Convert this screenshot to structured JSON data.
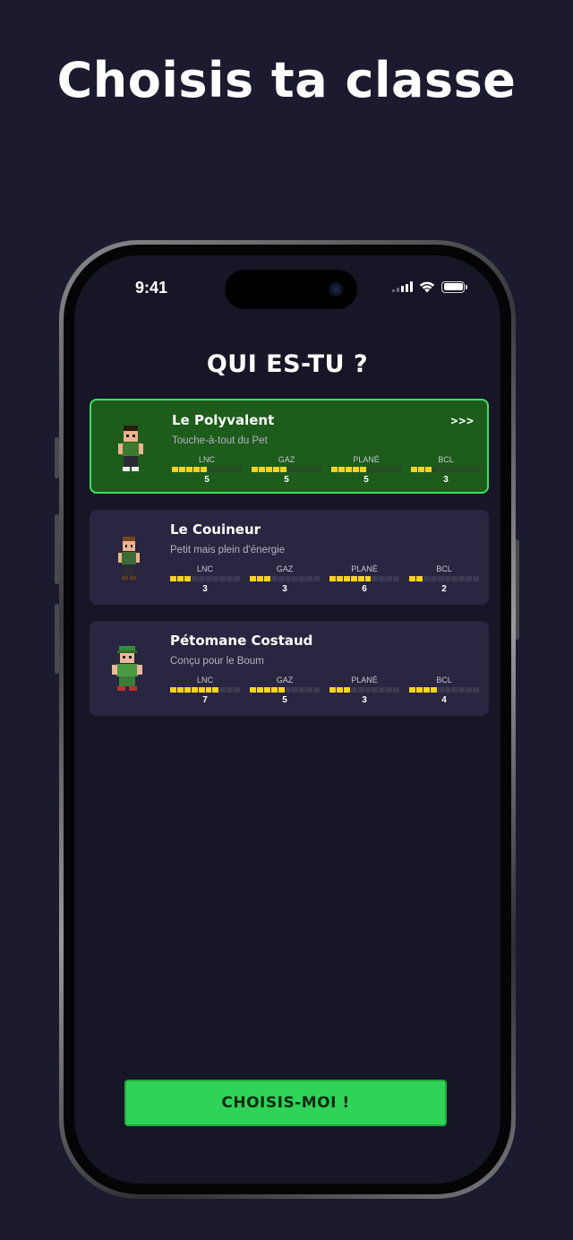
{
  "headline": "Choisis ta classe",
  "status_bar": {
    "time": "9:41"
  },
  "screen_title": "QUI ES-TU ?",
  "classes": [
    {
      "name": "Le Polyvalent",
      "subtitle": "Touche-à-tout du Pet",
      "selected": true,
      "arrows": ">>>",
      "avatar": "character-green-shirt-icon",
      "stats": [
        {
          "label": "LNC",
          "value": "5"
        },
        {
          "label": "GAZ",
          "value": "5"
        },
        {
          "label": "PLANÉ",
          "value": "5"
        },
        {
          "label": "BCL",
          "value": "3"
        }
      ]
    },
    {
      "name": "Le Couineur",
      "subtitle": "Petit mais plein d'énergie",
      "selected": false,
      "avatar": "character-small-brown-hair-icon",
      "stats": [
        {
          "label": "LNC",
          "value": "3"
        },
        {
          "label": "GAZ",
          "value": "3"
        },
        {
          "label": "PLANÉ",
          "value": "6"
        },
        {
          "label": "BCL",
          "value": "2"
        }
      ]
    },
    {
      "name": "Pétomane Costaud",
      "subtitle": "Conçu pour le Boum",
      "selected": false,
      "avatar": "character-green-cap-icon",
      "stats": [
        {
          "label": "LNC",
          "value": "7"
        },
        {
          "label": "GAZ",
          "value": "5"
        },
        {
          "label": "PLANÉ",
          "value": "3"
        },
        {
          "label": "BCL",
          "value": "4"
        }
      ]
    }
  ],
  "stat_bar_max": 10,
  "cta_label": "CHOISIS-MOI !",
  "colors": {
    "background": "#1c1a2e",
    "screen": "#171626",
    "card": "#282640",
    "card_selected": "#1d5c1a",
    "card_selected_border": "#3ee063",
    "stat_fill": "#ffd31c",
    "cta": "#2fd357"
  }
}
